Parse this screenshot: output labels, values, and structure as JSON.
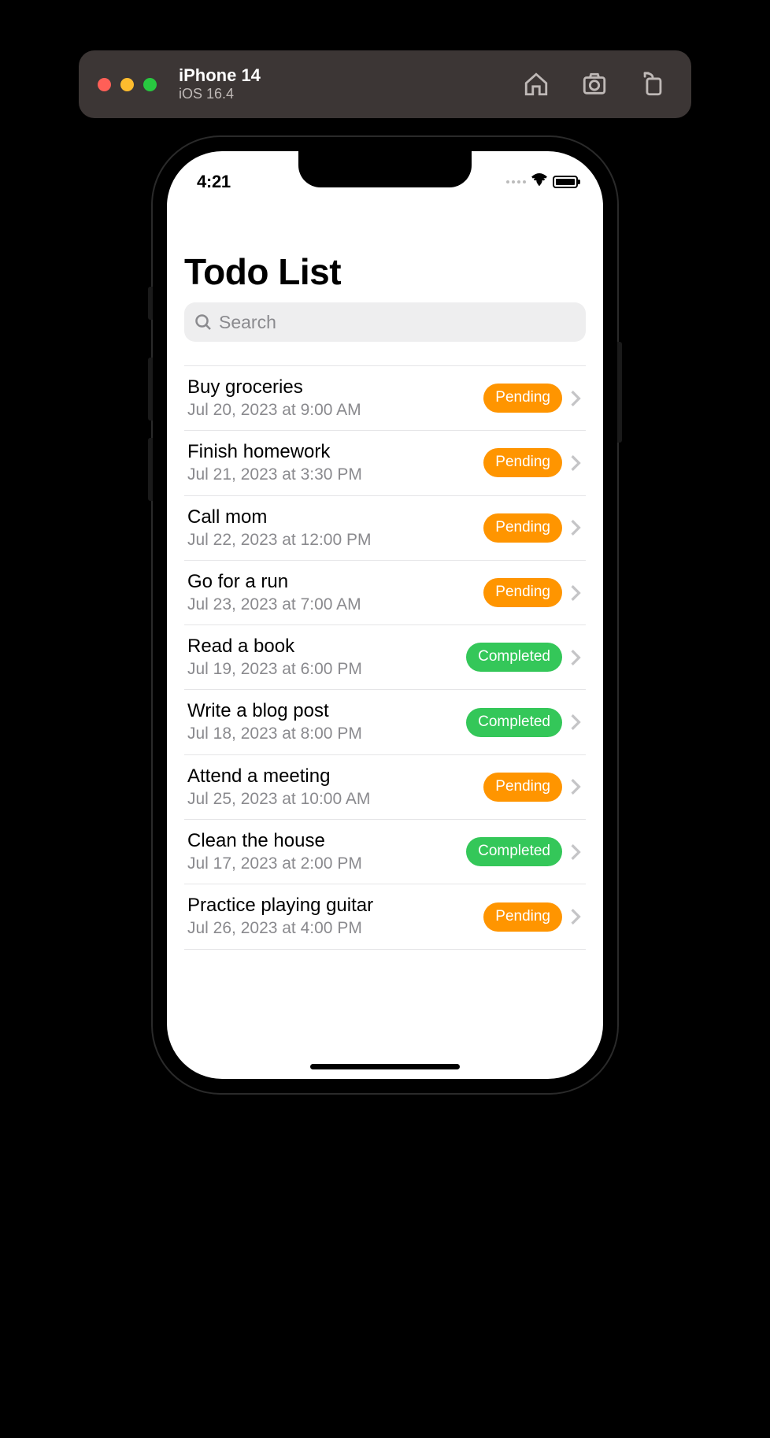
{
  "simulator": {
    "title": "iPhone 14",
    "subtitle": "iOS 16.4"
  },
  "status": {
    "time": "4:21"
  },
  "page": {
    "title": "Todo List"
  },
  "search": {
    "placeholder": "Search"
  },
  "status_labels": {
    "pending": "Pending",
    "completed": "Completed"
  },
  "colors": {
    "pending": "#ff9500",
    "completed": "#34c759"
  },
  "todos": [
    {
      "title": "Buy groceries",
      "date": "Jul 20, 2023 at 9:00 AM",
      "status": "pending"
    },
    {
      "title": "Finish homework",
      "date": "Jul 21, 2023 at 3:30 PM",
      "status": "pending"
    },
    {
      "title": "Call mom",
      "date": "Jul 22, 2023 at 12:00 PM",
      "status": "pending"
    },
    {
      "title": "Go for a run",
      "date": "Jul 23, 2023 at 7:00 AM",
      "status": "pending"
    },
    {
      "title": "Read a book",
      "date": "Jul 19, 2023 at 6:00 PM",
      "status": "completed"
    },
    {
      "title": "Write a blog post",
      "date": "Jul 18, 2023 at 8:00 PM",
      "status": "completed"
    },
    {
      "title": "Attend a meeting",
      "date": "Jul 25, 2023 at 10:00 AM",
      "status": "pending"
    },
    {
      "title": "Clean the house",
      "date": "Jul 17, 2023 at 2:00 PM",
      "status": "completed"
    },
    {
      "title": "Practice playing guitar",
      "date": "Jul 26, 2023 at 4:00 PM",
      "status": "pending"
    }
  ]
}
